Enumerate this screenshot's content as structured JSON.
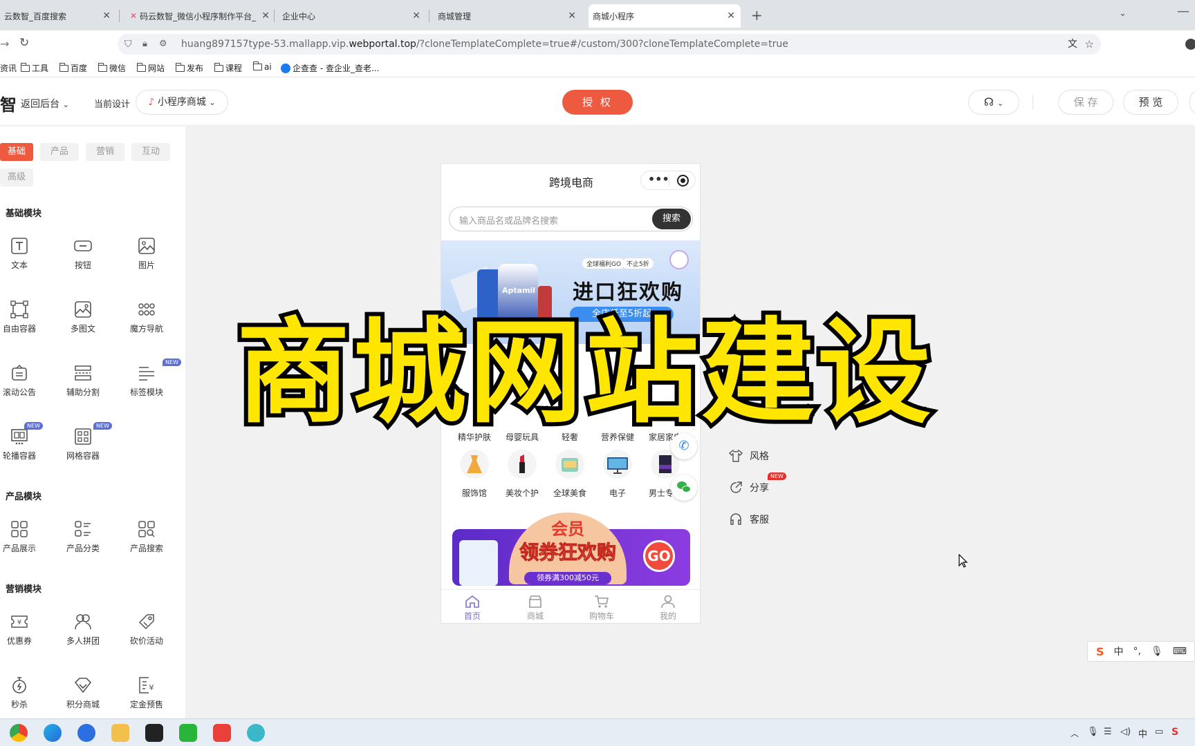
{
  "browser": {
    "tabs": [
      {
        "label": "云数智_百度搜索"
      },
      {
        "label": "码云数智_微信小程序制作平台_"
      },
      {
        "label": "企业中心"
      },
      {
        "label": "商城管理"
      },
      {
        "label": "商城小程序"
      }
    ],
    "url_prefix": "huang897157type-53.mallapp.vip.",
    "url_host": "webportal.top",
    "url_suffix": "/?cloneTemplateComplete=true#/custom/300?cloneTemplateComplete=true",
    "bookmarks": [
      "资讯",
      "工具",
      "百度",
      "微信",
      "网站",
      "发布",
      "课程",
      "ai",
      "企查查 - 查企业_查老..."
    ]
  },
  "header": {
    "logo": "智",
    "back_label": "返回后台",
    "current_design_label": "当前设计",
    "design_select": "小程序商城",
    "auth_label": "授 权",
    "save_label": "保 存",
    "preview_label": "预 览"
  },
  "left_panel": {
    "tabs": [
      "基础",
      "产品",
      "营销",
      "互动",
      "高级"
    ],
    "basic_title": "基础模块",
    "basic": [
      {
        "label": "文本"
      },
      {
        "label": "按钮"
      },
      {
        "label": "图片"
      },
      {
        "label": "自由容器"
      },
      {
        "label": "多图文"
      },
      {
        "label": "魔方导航"
      },
      {
        "label": "滚动公告"
      },
      {
        "label": "辅助分割"
      },
      {
        "label": "标签模块",
        "badge": "NEW"
      },
      {
        "label": "轮播容器",
        "badge": "NEW"
      },
      {
        "label": "网格容器",
        "badge": "NEW"
      }
    ],
    "product_title": "产品模块",
    "product": [
      {
        "label": "产品展示"
      },
      {
        "label": "产品分类"
      },
      {
        "label": "产品搜索"
      }
    ],
    "marketing_title": "营销模块",
    "marketing": [
      {
        "label": "优惠券"
      },
      {
        "label": "多人拼团"
      },
      {
        "label": "砍价活动"
      },
      {
        "label": "秒杀"
      },
      {
        "label": "积分商城"
      },
      {
        "label": "定金预售"
      }
    ]
  },
  "phone": {
    "title": "跨境电商",
    "search_placeholder": "输入商品名或品牌名搜索",
    "search_button": "搜索",
    "banner1": {
      "tag1": "全球福利GO",
      "tag2": "不止5折",
      "headline": "进口狂欢购",
      "sub": "全店低至5折起",
      "brand": "Aptamil"
    },
    "categories_row1": [
      "精华护肤",
      "母婴玩具",
      "轻奢",
      "营养保健",
      "家居家电"
    ],
    "categories_row2": [
      "服饰馆",
      "美妆个护",
      "全球美食",
      "电子",
      "男士专区"
    ],
    "banner2": {
      "line1": "会员",
      "line2": "领券狂欢购",
      "go": "GO",
      "sub": "领券满300减50元"
    },
    "nav": [
      {
        "label": "首页"
      },
      {
        "label": "商城"
      },
      {
        "label": "购物车"
      },
      {
        "label": "我的"
      }
    ]
  },
  "right_options": [
    {
      "label": "风格"
    },
    {
      "label": "分享",
      "badge": "NEW"
    },
    {
      "label": "客服"
    }
  ],
  "overlay_caption": "商城网站建设",
  "ime": {
    "mode": "中"
  },
  "colors": {
    "accent": "#ee5a3f",
    "caption": "#ffe600",
    "nav_active": "#7b6fd0"
  }
}
